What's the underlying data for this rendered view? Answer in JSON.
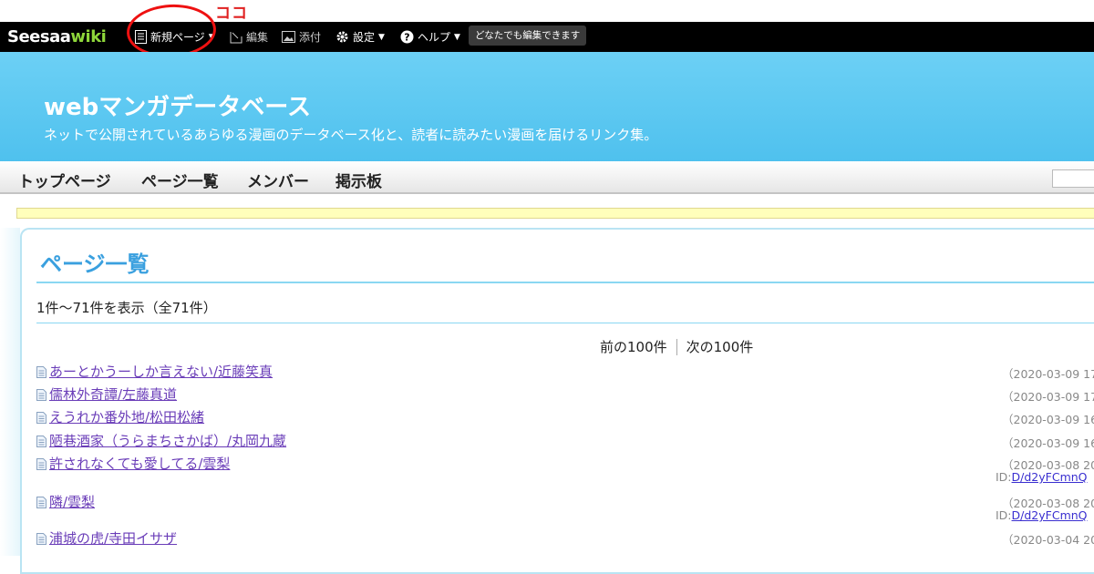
{
  "annotation": "ココ",
  "navbar": {
    "logo_main": "Seesaa",
    "logo_wiki": "wiki",
    "new_page": "新規ページ",
    "edit": "編集",
    "attach": "添付",
    "settings": "設定",
    "help": "ヘルプ",
    "badge": "どなたでも編集できます"
  },
  "header": {
    "title": "webマンガデータベース",
    "description": "ネットで公開されているあらゆる漫画のデータベース化と、読者に読みたい漫画を届けるリンク集。"
  },
  "menu": [
    "トップページ",
    "ページ一覧",
    "メンバー",
    "掲示板"
  ],
  "main": {
    "heading": "ページ一覧",
    "count": "1件～71件を表示（全71件）",
    "prev": "前の100件",
    "next": "次の100件"
  },
  "rows": [
    {
      "title": "あーとかうーしか言えない/近藤笑真",
      "date": "（2020-03-09 17",
      "id": ""
    },
    {
      "title": "儒林外奇譚/左藤真道",
      "date": "（2020-03-09 17",
      "id": ""
    },
    {
      "title": "えうれか番外地/松田松緒",
      "date": "（2020-03-09 16",
      "id": ""
    },
    {
      "title": "陋巷酒家（うらまちさかば）/丸岡九蔵",
      "date": "（2020-03-09 16",
      "id": ""
    },
    {
      "title": "許されなくても愛してる/雲梨",
      "date": "（2020-03-08 20",
      "id": "D/d2yFCmnQ"
    },
    {
      "title": "隣/雲梨",
      "date": "（2020-03-08 20",
      "id": "D/d2yFCmnQ"
    },
    {
      "title": "浦城の虎/寺田イサザ",
      "date": "（2020-03-04 20",
      "id": ""
    }
  ],
  "id_prefix": "ID:",
  "colors": {
    "header_blue": "#4fc1ee",
    "heading_blue": "#3aa0df",
    "link_purple": "#6a3db8",
    "annotation_red": "#e02020",
    "logo_green": "#8ed63a"
  },
  "icons": [
    "page-icon",
    "edit-icon",
    "image-icon",
    "gear-icon",
    "help-icon",
    "file-icon"
  ]
}
